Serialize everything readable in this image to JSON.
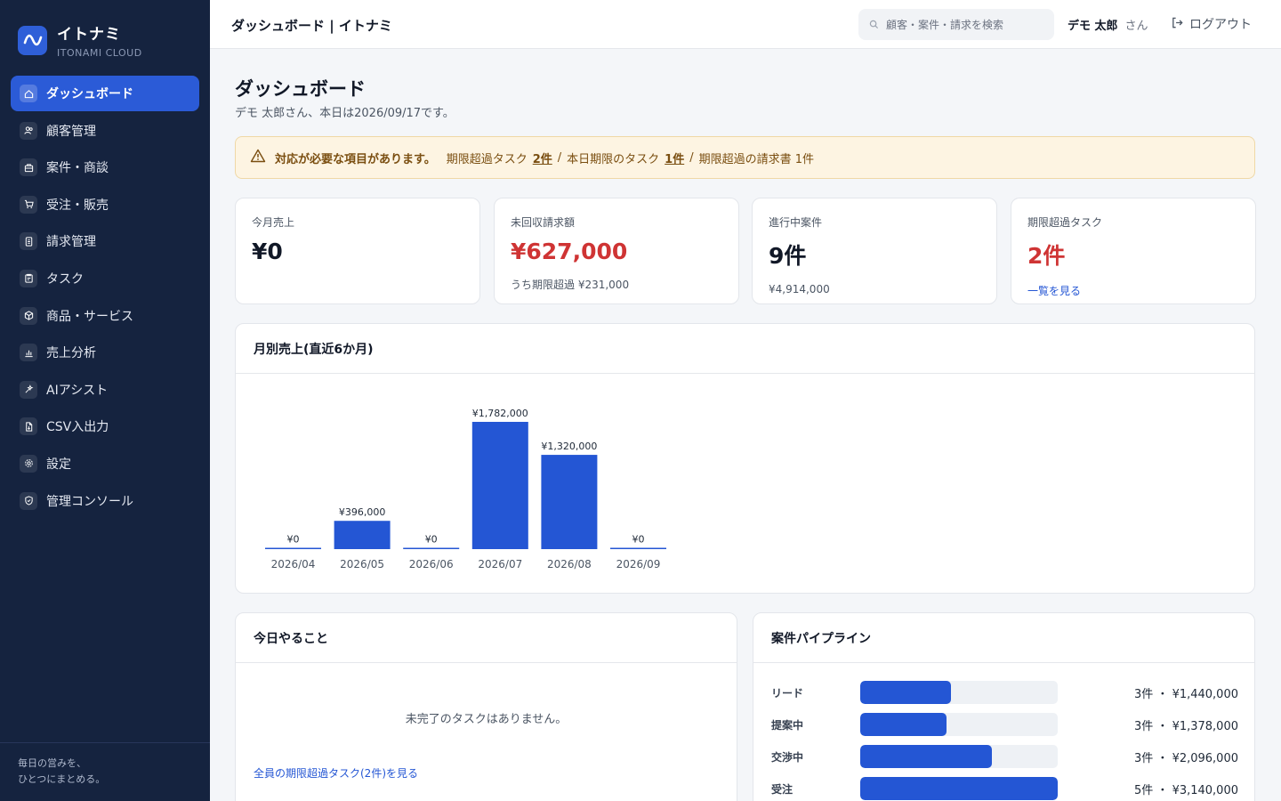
{
  "brand": {
    "name": "イトナミ",
    "sub": "ITONAMI CLOUD"
  },
  "sidebar": {
    "items": [
      {
        "label": "ダッシュボード",
        "icon": "home-icon"
      },
      {
        "label": "顧客管理",
        "icon": "users-icon"
      },
      {
        "label": "案件・商談",
        "icon": "briefcase-icon"
      },
      {
        "label": "受注・販売",
        "icon": "cart-icon"
      },
      {
        "label": "請求管理",
        "icon": "invoice-icon"
      },
      {
        "label": "タスク",
        "icon": "clipboard-icon"
      },
      {
        "label": "商品・サービス",
        "icon": "box-icon"
      },
      {
        "label": "売上分析",
        "icon": "bar-chart-icon"
      },
      {
        "label": "AIアシスト",
        "icon": "sparkle-icon"
      },
      {
        "label": "CSV入出力",
        "icon": "file-icon"
      },
      {
        "label": "設定",
        "icon": "gear-icon"
      },
      {
        "label": "管理コンソール",
        "icon": "shield-icon"
      }
    ],
    "footer_line1": "毎日の営みを、",
    "footer_line2": "ひとつにまとめる。"
  },
  "header": {
    "title": "ダッシュボード | イトナミ",
    "search_placeholder": "顧客・案件・請求を検索",
    "user_name": "デモ 太郎",
    "user_suffix": "さん",
    "logout": "ログアウト"
  },
  "page": {
    "title": "ダッシュボード",
    "subtitle": "デモ 太郎さん、本日は2026/09/17です。"
  },
  "alert": {
    "lead": "対応が必要な項目があります。",
    "overdue_tasks_label": "期限超過タスク",
    "overdue_tasks_link": "2件",
    "sep1": "/",
    "due_today_label": "本日期限のタスク",
    "due_today_link": "1件",
    "sep2": "/",
    "overdue_invoices": "期限超過の請求書 1件"
  },
  "kpis": [
    {
      "label": "今月売上",
      "value": "¥0",
      "sub": ""
    },
    {
      "label": "未回収請求額",
      "value": "¥627,000",
      "sub": "うち期限超過 ¥231,000"
    },
    {
      "label": "進行中案件",
      "value": "9件",
      "sub": "¥4,914,000"
    },
    {
      "label": "期限超過タスク",
      "value": "2件",
      "link": "一覧を見る"
    }
  ],
  "colors": {
    "accent": "#2456d4",
    "danger": "#cf3434",
    "sidebar": "#15233f"
  },
  "chart_card": {
    "title": "月別売上(直近6か月)"
  },
  "chart_data": {
    "type": "bar",
    "categories": [
      "2026/04",
      "2026/05",
      "2026/06",
      "2026/07",
      "2026/08",
      "2026/09"
    ],
    "values": [
      0,
      396000,
      0,
      1782000,
      1320000,
      0
    ],
    "value_labels": [
      "¥0",
      "¥396,000",
      "¥0",
      "¥1,782,000",
      "¥1,320,000",
      "¥0"
    ],
    "title": "月別売上(直近6か月)",
    "xlabel": "",
    "ylabel": "",
    "ylim": [
      0,
      1782000
    ],
    "grid": false,
    "legend": "none"
  },
  "today": {
    "title": "今日やること",
    "empty": "未完了のタスクはありません。",
    "link": "全員の期限超過タスク(2件)を見る"
  },
  "pipeline": {
    "title": "案件パイプライン",
    "rows": [
      {
        "label": "リード",
        "value": "3件 ・ ¥1,440,000",
        "amount": 1440000
      },
      {
        "label": "提案中",
        "value": "3件 ・ ¥1,378,000",
        "amount": 1378000
      },
      {
        "label": "交渉中",
        "value": "3件 ・ ¥2,096,000",
        "amount": 2096000
      },
      {
        "label": "受注",
        "value": "5件 ・ ¥3,140,000",
        "amount": 3140000
      }
    ]
  }
}
